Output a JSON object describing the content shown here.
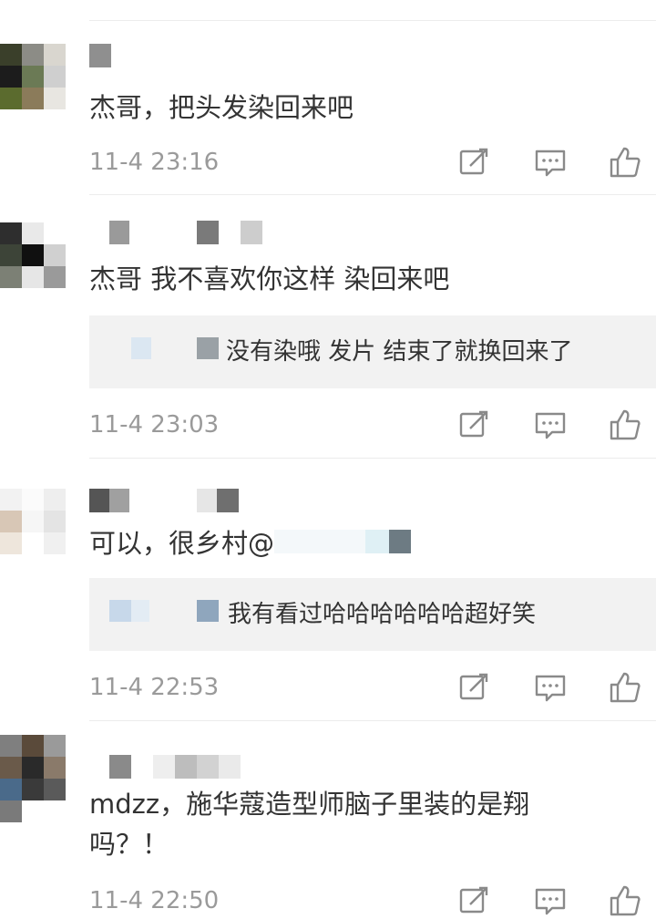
{
  "comments": [
    {
      "text": "杰哥，把头发染回来吧",
      "time": "11-4 23:16"
    },
    {
      "text": "杰哥 我不喜欢你这样 染回来吧",
      "time": "11-4 23:03",
      "reply": {
        "text": "没有染哦 发片 结束了就换回来了"
      }
    },
    {
      "text": "可以，很乡村@",
      "time": "11-4 22:53",
      "reply": {
        "text": "我有看过哈哈哈哈哈哈超好笑"
      }
    },
    {
      "text": "mdzz，施华蔻造型师脑子里装的是翔吗？！",
      "time": "11-4 22:50"
    }
  ],
  "icons": {
    "share": "share-edit-icon",
    "reply": "comment-bubble-icon",
    "like": "thumbs-up-icon"
  },
  "colors": {
    "text": "#333333",
    "time": "#9a9a9a",
    "icon": "#8a8a8a",
    "reply_bg": "#f2f2f2",
    "divider": "#ececec"
  }
}
